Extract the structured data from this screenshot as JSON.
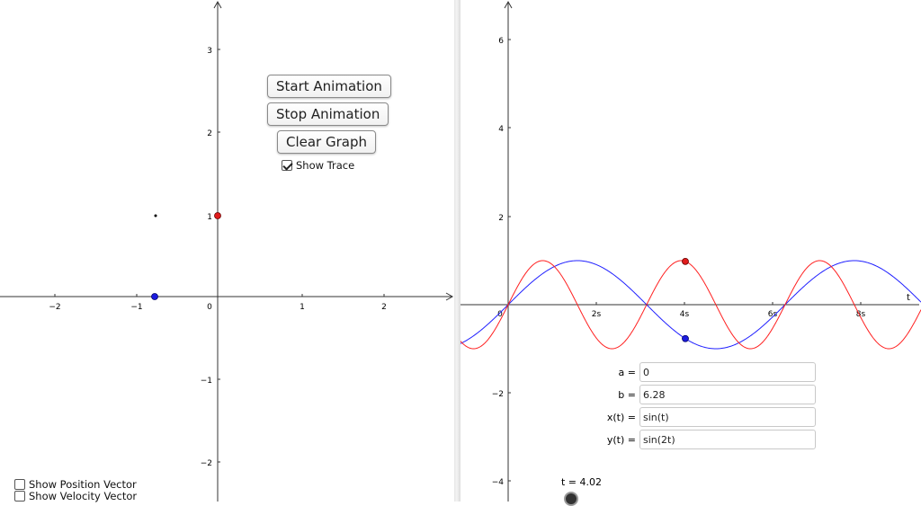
{
  "left_graph": {
    "x_ticks": [
      "−2",
      "−1",
      "0",
      "1",
      "2"
    ],
    "y_ticks": [
      "3",
      "2",
      "1",
      "−1",
      "−2"
    ],
    "points": {
      "trace_point": {
        "x": -0.75,
        "y": 1.0,
        "color": "#000000"
      },
      "red_point": {
        "x": 0.0,
        "y": 1.0,
        "color": "#e01b1b"
      },
      "blue_point": {
        "x": -0.77,
        "y": 0.0,
        "color": "#1b1be0"
      }
    }
  },
  "buttons": {
    "start": "Start Animation",
    "stop": "Stop Animation",
    "clear": "Clear Graph"
  },
  "checkboxes": {
    "show_trace": {
      "label": "Show Trace",
      "checked": true
    },
    "show_position_vector": {
      "label": "Show Position Vector",
      "checked": false
    },
    "show_velocity_vector": {
      "label": "Show Velocity Vector",
      "checked": false
    }
  },
  "right_graph": {
    "axis_label_t": "t",
    "x_ticks": [
      "0",
      "2s",
      "4s",
      "6s",
      "8s"
    ],
    "y_ticks": [
      "6",
      "4",
      "2",
      "−2",
      "−4"
    ],
    "curves": {
      "x_of_t": {
        "expr": "sin(t)",
        "color": "#2020ff"
      },
      "y_of_t": {
        "expr": "sin(2t)",
        "color": "#ff2020"
      }
    },
    "marker_t": 4.02
  },
  "fields": {
    "a": {
      "label": "a =",
      "value": "0"
    },
    "b": {
      "label": "b =",
      "value": "6.28"
    },
    "x": {
      "label": "x(t) =",
      "value": "sin(t)"
    },
    "y": {
      "label": "y(t) =",
      "value": "sin(2t)"
    }
  },
  "slider": {
    "label": "t = 4.02",
    "value": 4.02
  }
}
